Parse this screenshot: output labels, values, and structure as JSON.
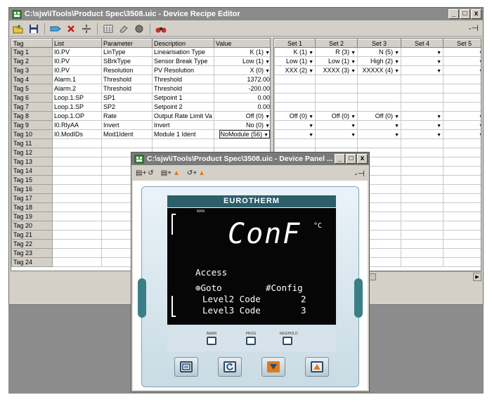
{
  "main_window": {
    "title": "C:\\sjw\\iTools\\Product Spec\\3508.uic - Device Recipe Editor",
    "controls": {
      "minimize": "_",
      "maximize": "□",
      "close": "x"
    },
    "pin": "-⊣",
    "toolbar_icons": [
      "open-icon",
      "save-icon",
      "tag-icon",
      "delete-icon",
      "split-icon",
      "grid-icon",
      "eraser-icon",
      "record-icon",
      "binoculars-icon"
    ]
  },
  "recipe_table": {
    "headers": [
      "Tag",
      "List",
      "Parameter",
      "Description",
      "Value"
    ],
    "rows": [
      [
        "Tag 1",
        "I0.PV",
        "LinType",
        "Linearisation Type",
        "K (1)"
      ],
      [
        "Tag 2",
        "I0.PV",
        "SBrkType",
        "Sensor Break Type",
        "Low (1)"
      ],
      [
        "Tag 3",
        "I0.PV",
        "Resolution",
        "PV Resolution",
        "X (0)"
      ],
      [
        "Tag 4",
        "Alarm.1",
        "Threshold",
        "Threshold",
        "1372.00"
      ],
      [
        "Tag 5",
        "Alarm.2",
        "Threshold",
        "Threshold",
        "-200.00"
      ],
      [
        "Tag 6",
        "Loop.1.SP",
        "SP1",
        "Setpoint 1",
        "0.00"
      ],
      [
        "Tag 7",
        "Loop.1.SP",
        "SP2",
        "Setpoint 2",
        "0.00"
      ],
      [
        "Tag 8",
        "Loop.1.OP",
        "Rate",
        "Output Rate Limit Va",
        "Off (0)"
      ],
      [
        "Tag 9",
        "I0.RlyAA",
        "Invert",
        "Invert",
        "No (0)"
      ],
      [
        "Tag 10",
        "I0.ModIDs",
        "Mod1Ident",
        "Module 1 Ident",
        "NoModule (56)"
      ],
      [
        "Tag 11",
        "",
        "",
        "",
        ""
      ],
      [
        "Tag 12",
        "",
        "",
        "",
        ""
      ],
      [
        "Tag 13",
        "",
        "",
        "",
        ""
      ],
      [
        "Tag 14",
        "",
        "",
        "",
        ""
      ],
      [
        "Tag 15",
        "",
        "",
        "",
        ""
      ],
      [
        "Tag 16",
        "",
        "",
        "",
        ""
      ],
      [
        "Tag 17",
        "",
        "",
        "",
        ""
      ],
      [
        "Tag 18",
        "",
        "",
        "",
        ""
      ],
      [
        "Tag 19",
        "",
        "",
        "",
        ""
      ],
      [
        "Tag 20",
        "",
        "",
        "",
        ""
      ],
      [
        "Tag 21",
        "",
        "",
        "",
        ""
      ],
      [
        "Tag 22",
        "",
        "",
        "",
        ""
      ],
      [
        "Tag 23",
        "",
        "",
        "",
        ""
      ],
      [
        "Tag 24",
        "",
        "",
        "",
        ""
      ]
    ],
    "dropdown_rows": [
      0,
      1,
      2,
      7,
      8,
      9
    ]
  },
  "sets_table": {
    "headers": [
      "Set 1",
      "Set 2",
      "Set 3",
      "Set 4",
      "Set 5"
    ],
    "rows": [
      [
        "K (1)",
        "R (3)",
        "N (5)",
        "",
        ""
      ],
      [
        "Low (1)",
        "Low (1)",
        "High (2)",
        "",
        ""
      ],
      [
        "XXX (2)",
        "XXXX (3)",
        "XXXXX (4)",
        "",
        ""
      ],
      [
        "",
        "",
        "",
        "",
        ""
      ],
      [
        "",
        "",
        "",
        "",
        ""
      ],
      [
        "",
        "",
        "",
        "",
        ""
      ],
      [
        "",
        "",
        "",
        "",
        ""
      ],
      [
        "Off (0)",
        "Off (0)",
        "Off (0)",
        "",
        ""
      ],
      [
        "",
        "",
        "",
        "",
        ""
      ],
      [
        "",
        "",
        "",
        "",
        ""
      ]
    ],
    "dropdown_rows": [
      0,
      1,
      2,
      7,
      8,
      9
    ]
  },
  "panel_window": {
    "title": "C:\\sjw\\iTools\\Product Spec\\3508.uic - Device Panel ...",
    "controls": {
      "minimize": "_",
      "maximize": "□",
      "close": "x"
    },
    "pin": "-⊣",
    "toolbar": [
      {
        "prefix": "▤+",
        "suffix": "↺"
      },
      {
        "prefix": "▤+",
        "suffix": "▲"
      },
      {
        "prefix": "↺+",
        "suffix": "▲"
      }
    ]
  },
  "device": {
    "brand": "EUROTHERM",
    "mode": "MAN",
    "main_display": "ConF",
    "unit": "°C",
    "lines": [
      {
        "text": "Access"
      },
      {
        "text": "⊕Goto",
        "value": "#Config"
      },
      {
        "text": "Level2 Code",
        "value": "2"
      },
      {
        "text": "Level3 Code",
        "value": "3"
      }
    ],
    "small_buttons": [
      "AMAN",
      "PROG",
      "RES/HOLD"
    ],
    "keys": [
      "page-icon",
      "scroll-icon",
      "down-icon",
      "up-icon"
    ],
    "key_color": "#e07a1a"
  }
}
